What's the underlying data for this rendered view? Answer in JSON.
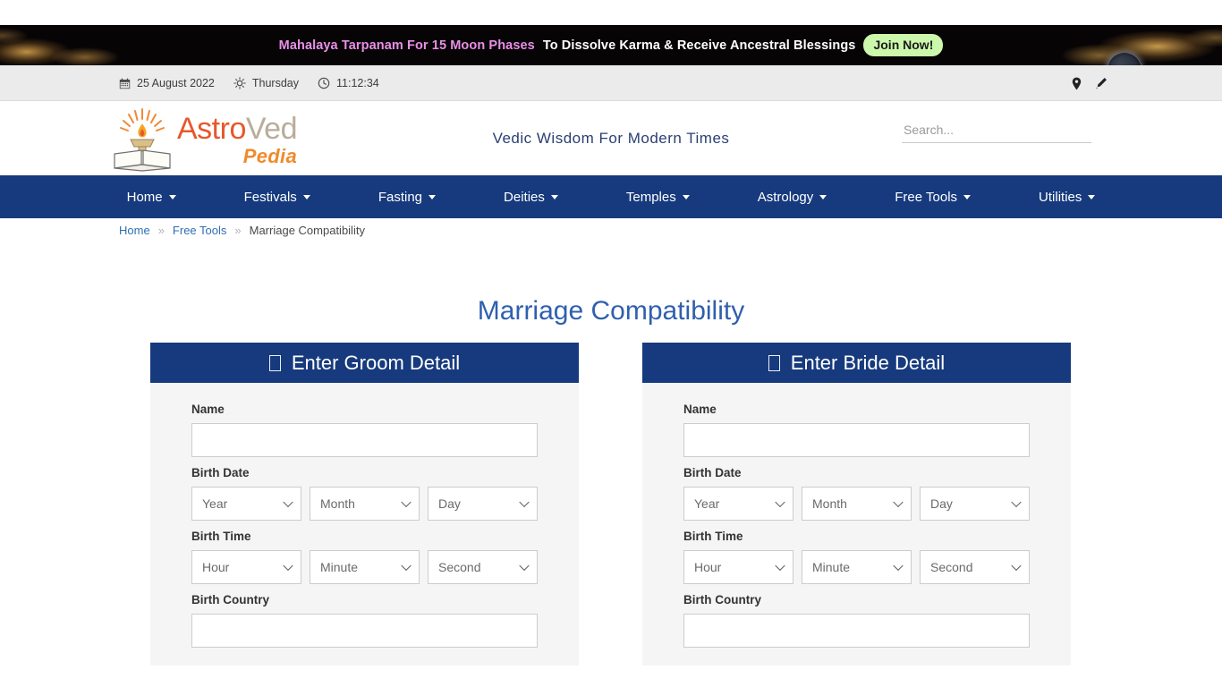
{
  "promo": {
    "highlight_text": "Mahalaya Tarpanam For 15 Moon Phases",
    "main_text": "To Dissolve Karma & Receive Ancestral Blessings",
    "cta_label": "Join Now!",
    "highlight_color": "#ea8fe8",
    "cta_bg": "#ccf8ac",
    "moon_icon": "moon-icon"
  },
  "info_bar": {
    "calendar_icon": "calendar-icon",
    "date": "25 August 2022",
    "sun_icon": "sun-icon",
    "day": "Thursday",
    "clock_icon": "clock-icon",
    "time": "11:12:34",
    "location_icon": "location-pin-icon",
    "edit_icon": "pencil-edit-icon"
  },
  "header": {
    "logo_part1": "Astro",
    "logo_part2": "Ved",
    "logo_part3": "Pedia",
    "logo_icon": "oil-lamp-on-book-icon",
    "tagline": "Vedic Wisdom For Modern Times",
    "accent_orange": "#e8572a",
    "accent_navy": "#163a7d"
  },
  "search": {
    "placeholder": "Search...",
    "value": ""
  },
  "nav": {
    "items": [
      {
        "label": "Home",
        "has_caret": true
      },
      {
        "label": "Festivals",
        "has_caret": true
      },
      {
        "label": "Fasting",
        "has_caret": true
      },
      {
        "label": "Deities",
        "has_caret": true
      },
      {
        "label": "Temples",
        "has_caret": true
      },
      {
        "label": "Astrology",
        "has_caret": true
      },
      {
        "label": "Free Tools",
        "has_caret": true
      },
      {
        "label": "Utilities",
        "has_caret": true
      }
    ]
  },
  "breadcrumb": {
    "home": "Home",
    "sep1": "»",
    "parent": "Free Tools",
    "sep2": "»",
    "current": "Marriage Compatibility"
  },
  "page": {
    "title": "Marriage Compatibility"
  },
  "groom": {
    "heading": "Enter Groom Detail",
    "heading_icon": "missing-glyph-box-icon",
    "name_label": "Name",
    "name_value": "",
    "birth_date_label": "Birth Date",
    "year": "Year",
    "month": "Month",
    "day": "Day",
    "birth_time_label": "Birth Time",
    "hour": "Hour",
    "minute": "Minute",
    "second": "Second",
    "birth_country_label": "Birth Country",
    "birth_country_value": ""
  },
  "bride": {
    "heading": "Enter Bride Detail",
    "heading_icon": "missing-glyph-box-icon",
    "name_label": "Name",
    "name_value": "",
    "birth_date_label": "Birth Date",
    "year": "Year",
    "month": "Month",
    "day": "Day",
    "birth_time_label": "Birth Time",
    "hour": "Hour",
    "minute": "Minute",
    "second": "Second",
    "birth_country_label": "Birth Country",
    "birth_country_value": ""
  }
}
